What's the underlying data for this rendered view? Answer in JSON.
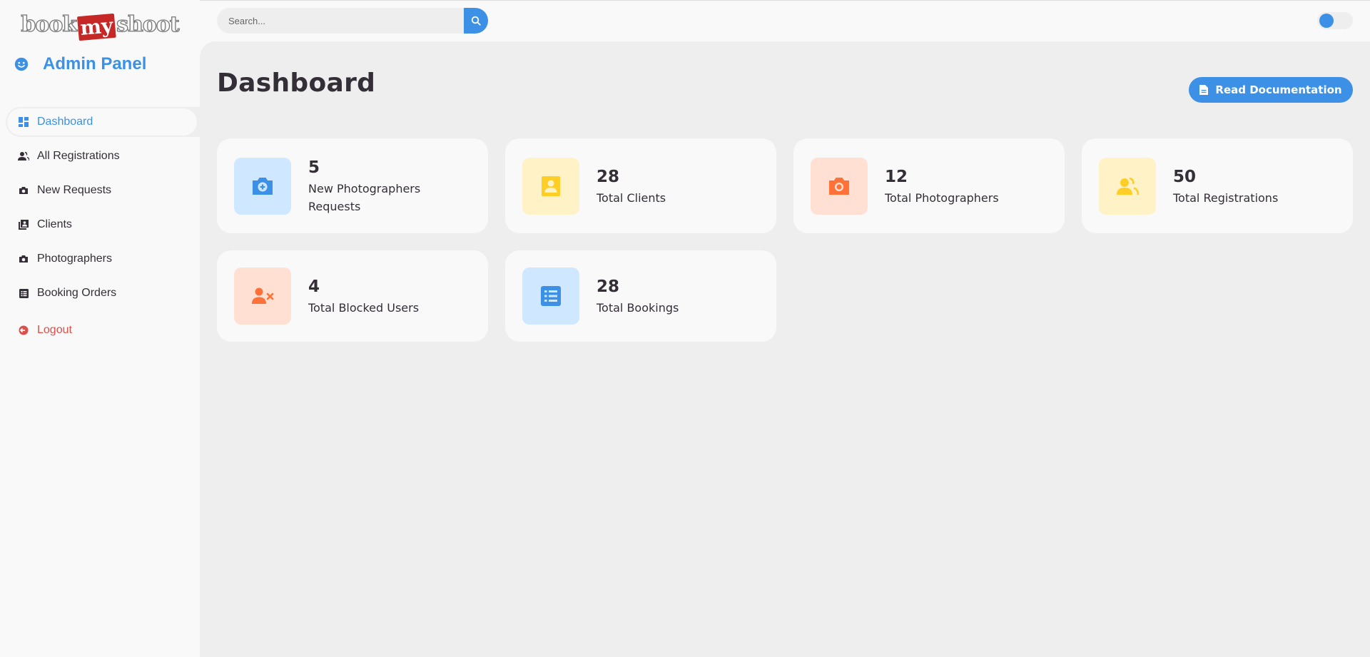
{
  "logo": {
    "part1": "book",
    "part2": "my",
    "part3": "shoot"
  },
  "sidebar": {
    "title": "Admin Panel",
    "items": [
      {
        "label": "Dashboard",
        "icon": "dashboard-icon",
        "active": true
      },
      {
        "label": "All Registrations",
        "icon": "users-icon"
      },
      {
        "label": "New Requests",
        "icon": "camera-icon"
      },
      {
        "label": "Clients",
        "icon": "contacts-icon"
      },
      {
        "label": "Photographers",
        "icon": "camera-icon"
      },
      {
        "label": "Booking Orders",
        "icon": "list-icon"
      }
    ],
    "logout": "Logout"
  },
  "search": {
    "placeholder": "Search..."
  },
  "page": {
    "title": "Dashboard",
    "doc_button": "Read Documentation"
  },
  "stats": [
    {
      "value": "5",
      "label": "New Photographers Requests",
      "icon": "camera-plus-icon",
      "color": "#3c91e6"
    },
    {
      "value": "28",
      "label": "Total Clients",
      "icon": "contact-card-icon",
      "color": "#ffce26"
    },
    {
      "value": "12",
      "label": "Total Photographers",
      "icon": "camera-icon",
      "color": "#fd7238"
    },
    {
      "value": "50",
      "label": "Total Registrations",
      "icon": "users-icon",
      "color": "#ffce26"
    },
    {
      "value": "4",
      "label": "Total Blocked Users",
      "icon": "user-block-icon",
      "color": "#fd7238"
    },
    {
      "value": "28",
      "label": "Total Bookings",
      "icon": "list-icon",
      "color": "#3c91e6"
    }
  ],
  "colors": {
    "accent": "#3c91e6",
    "yellow": "#ffce26",
    "orange": "#fd7238",
    "danger": "#db504a"
  }
}
